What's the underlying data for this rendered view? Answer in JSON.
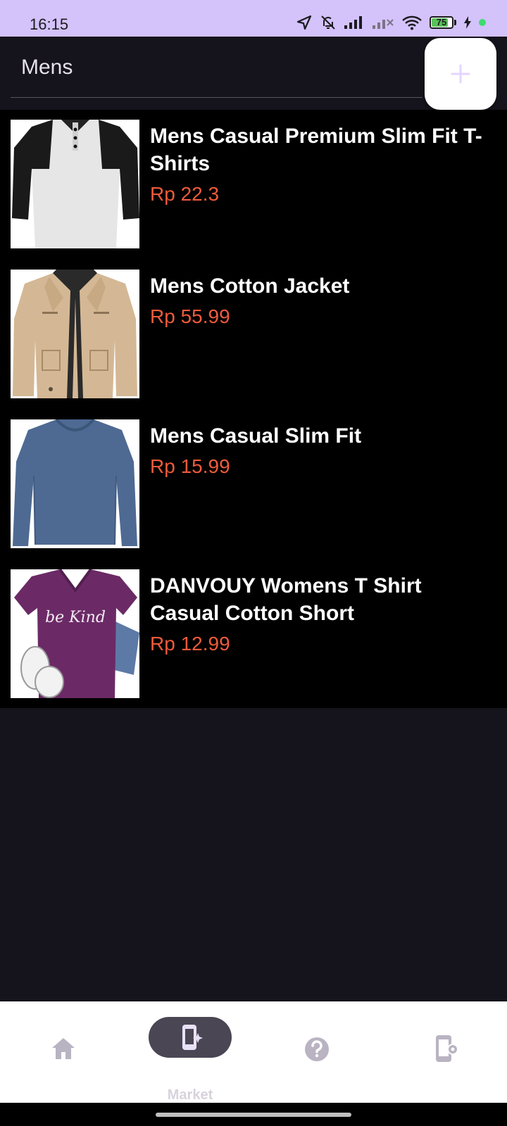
{
  "status_bar": {
    "time": "16:15",
    "battery": "75",
    "battery_level": 0.75,
    "icons": [
      "location-arrow-icon",
      "bell-off-icon",
      "signal-icon",
      "signal-no-service-icon",
      "wifi-icon",
      "battery-icon",
      "charging-bolt-icon",
      "green-privacy-dot-icon"
    ]
  },
  "header": {
    "title": "Mens",
    "add_icon": "plus-icon"
  },
  "products": [
    {
      "name": "Mens Casual Premium Slim Fit T-Shirts",
      "price": "Rp 22.3",
      "image": "raglan-tshirt-image"
    },
    {
      "name": "Mens Cotton Jacket",
      "price": "Rp 55.99",
      "image": "beige-jacket-image"
    },
    {
      "name": "Mens Casual Slim Fit",
      "price": "Rp 15.99",
      "image": "blue-longsleeve-image"
    },
    {
      "name": "DANVOUY Womens T Shirt Casual Cotton Short",
      "price": "Rp 12.99",
      "image": "purple-vneck-tshirt-image",
      "image_text": "be Kind"
    }
  ],
  "bottom_nav": {
    "items": [
      {
        "icon": "home-icon",
        "label": ""
      },
      {
        "icon": "market-icon",
        "label": "Market",
        "active": true
      },
      {
        "icon": "help-icon",
        "label": ""
      },
      {
        "icon": "device-settings-icon",
        "label": ""
      }
    ]
  },
  "colors": {
    "status_bar": "#d4c2fb",
    "background": "#15131b",
    "list_background": "#000000",
    "price": "#ee5b3b",
    "nav_active_pill": "#4b4654"
  }
}
